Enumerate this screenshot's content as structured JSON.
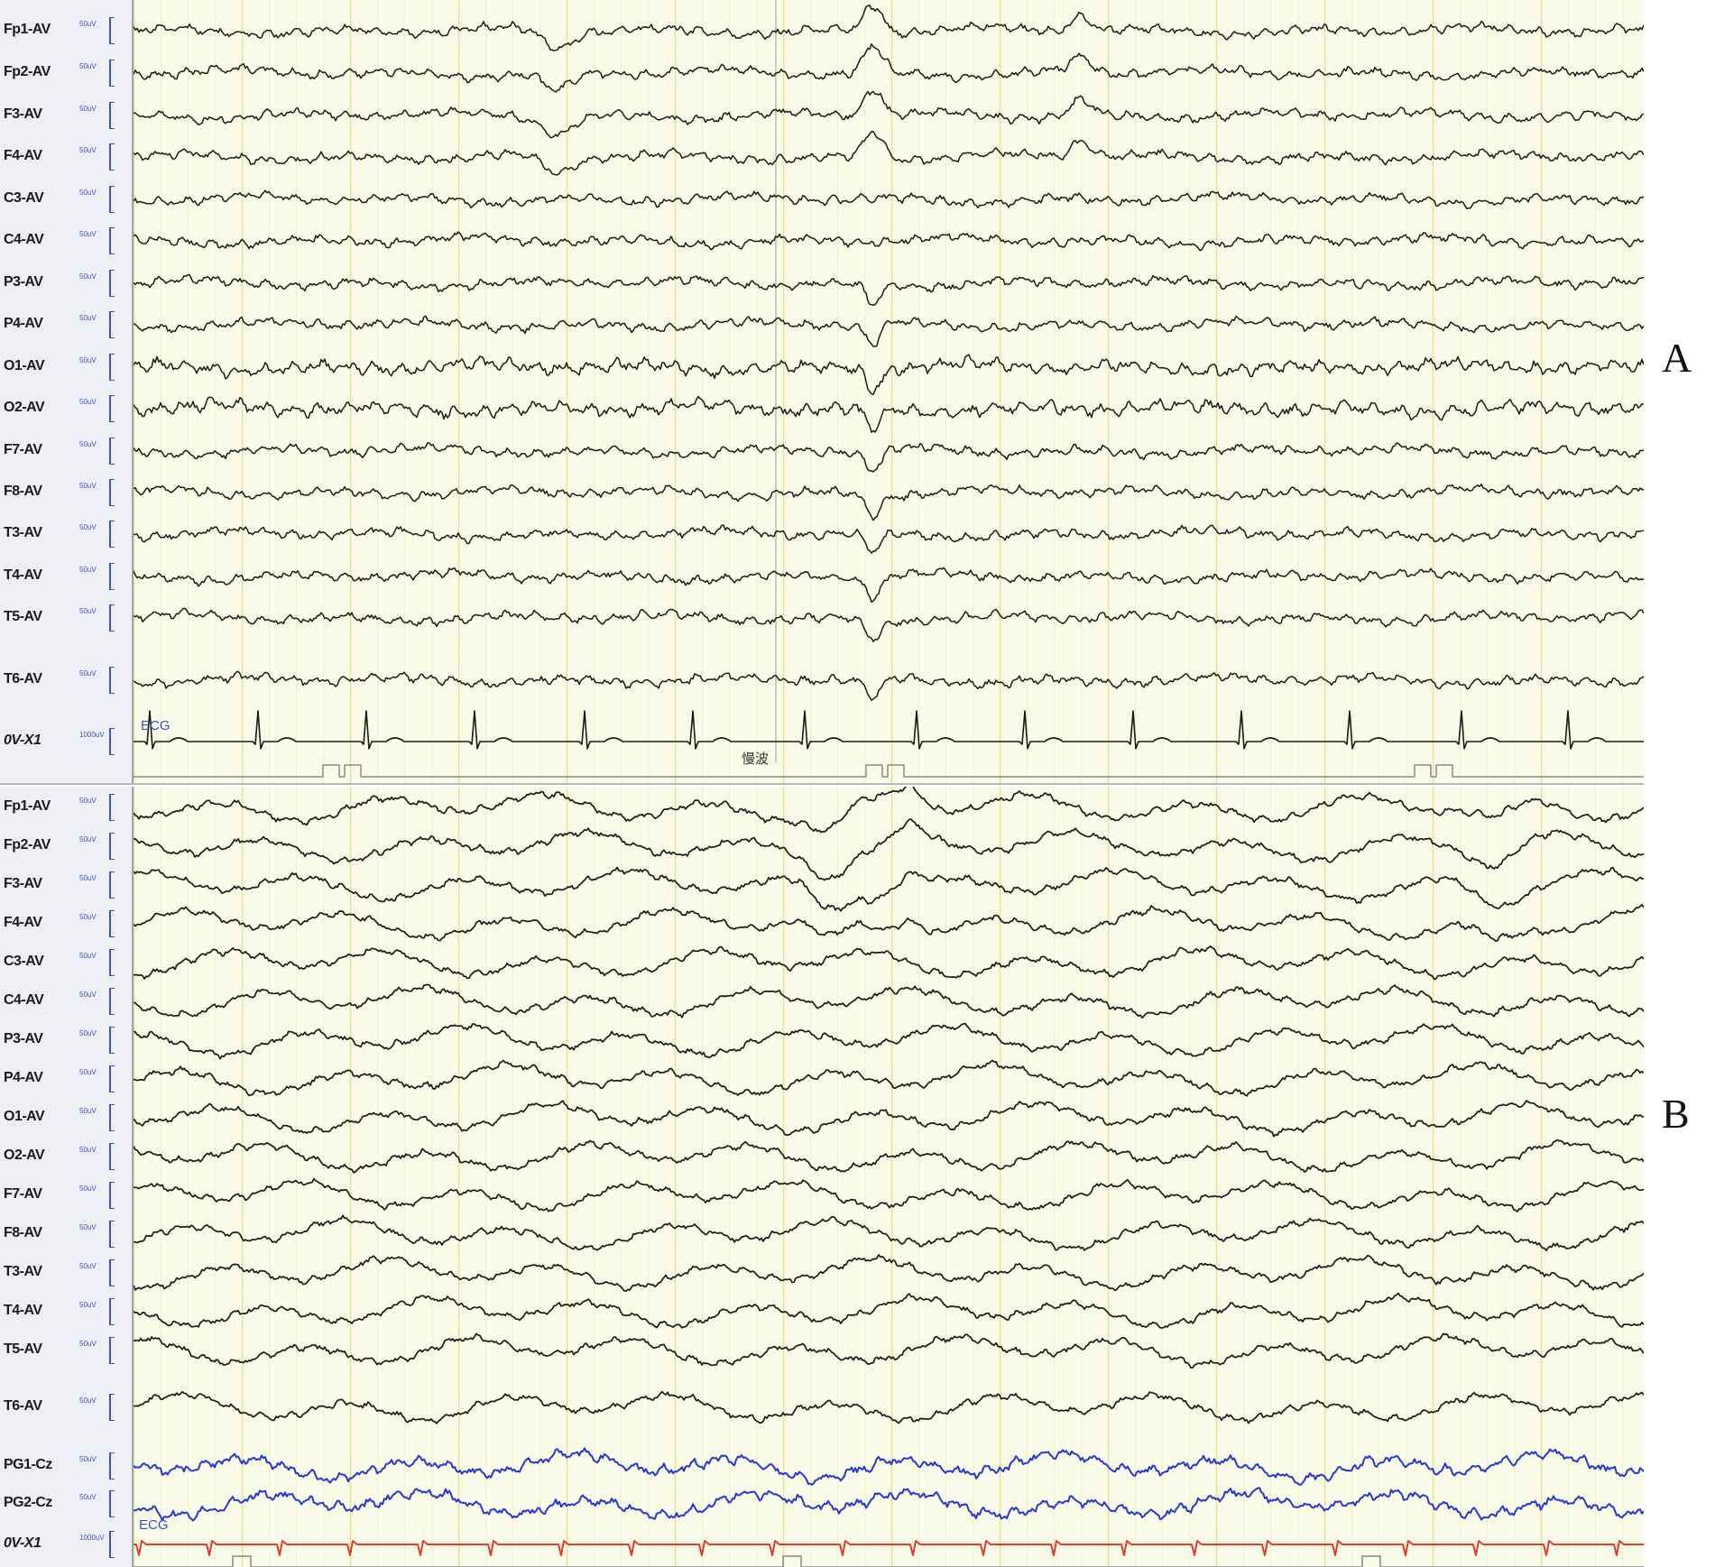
{
  "colors": {
    "background": "#fbfbe9",
    "trace": "#1a1a1a",
    "pg_trace": "#2438d8",
    "ecg_trace_b": "#e43a2a",
    "gridline": "#e8e59a",
    "label_blue": "#3a52c8"
  },
  "panels": [
    {
      "letter": "A",
      "channels": [
        {
          "label": "Fp1-AV",
          "gain": "50uV"
        },
        {
          "label": "Fp2-AV",
          "gain": "50uV"
        },
        {
          "label": "F3-AV",
          "gain": "50uV"
        },
        {
          "label": "F4-AV",
          "gain": "50uV"
        },
        {
          "label": "C3-AV",
          "gain": "50uV"
        },
        {
          "label": "C4-AV",
          "gain": "50uV"
        },
        {
          "label": "P3-AV",
          "gain": "50uV"
        },
        {
          "label": "P4-AV",
          "gain": "50uV"
        },
        {
          "label": "O1-AV",
          "gain": "50uV"
        },
        {
          "label": "O2-AV",
          "gain": "50uV"
        },
        {
          "label": "F7-AV",
          "gain": "50uV"
        },
        {
          "label": "F8-AV",
          "gain": "50uV"
        },
        {
          "label": "T3-AV",
          "gain": "50uV"
        },
        {
          "label": "T4-AV",
          "gain": "50uV"
        },
        {
          "label": "T5-AV",
          "gain": "50uV"
        },
        {
          "label": "T6-AV",
          "gain": "50uV"
        },
        {
          "label": "0V-X1",
          "gain": "1000uV",
          "kind": "ecg"
        }
      ],
      "ecg_tag": "ECG",
      "annotation": "慢波"
    },
    {
      "letter": "B",
      "channels": [
        {
          "label": "Fp1-AV",
          "gain": "50uV"
        },
        {
          "label": "Fp2-AV",
          "gain": "50uV"
        },
        {
          "label": "F3-AV",
          "gain": "50uV"
        },
        {
          "label": "F4-AV",
          "gain": "50uV"
        },
        {
          "label": "C3-AV",
          "gain": "50uV"
        },
        {
          "label": "C4-AV",
          "gain": "50uV"
        },
        {
          "label": "P3-AV",
          "gain": "50uV"
        },
        {
          "label": "P4-AV",
          "gain": "50uV"
        },
        {
          "label": "O1-AV",
          "gain": "50uV"
        },
        {
          "label": "O2-AV",
          "gain": "50uV"
        },
        {
          "label": "F7-AV",
          "gain": "50uV"
        },
        {
          "label": "F8-AV",
          "gain": "50uV"
        },
        {
          "label": "T3-AV",
          "gain": "50uV"
        },
        {
          "label": "T4-AV",
          "gain": "50uV"
        },
        {
          "label": "T5-AV",
          "gain": "50uV"
        },
        {
          "label": "T6-AV",
          "gain": "50uV"
        },
        {
          "label": "PG1-Cz",
          "gain": "50uV",
          "kind": "pg"
        },
        {
          "label": "PG2-Cz",
          "gain": "50uV",
          "kind": "pg"
        },
        {
          "label": "0V-X1",
          "gain": "1000uV",
          "kind": "ecg"
        }
      ],
      "ecg_tag": "ECG"
    }
  ]
}
